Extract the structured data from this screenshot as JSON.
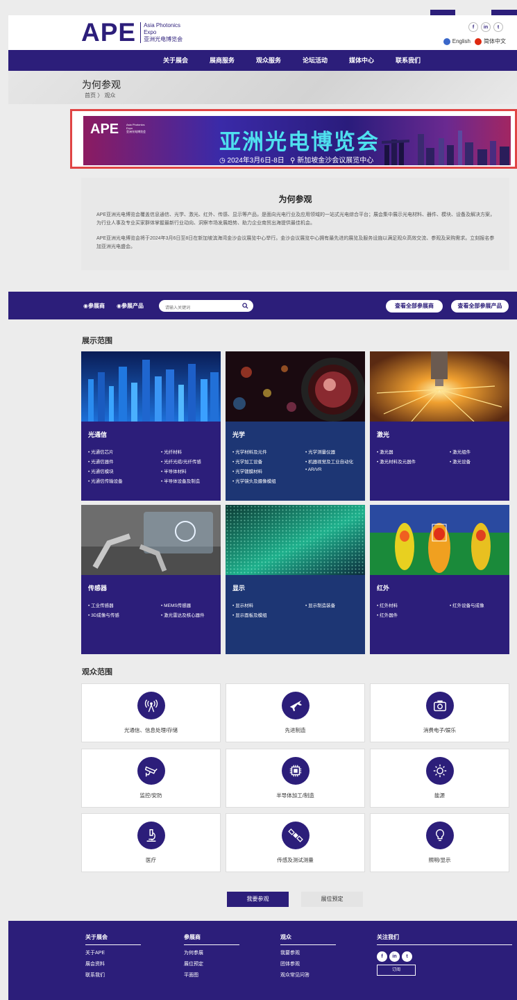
{
  "header": {
    "logo": "APE",
    "logo_sub1": "Asia Photonics",
    "logo_sub2": "Expo",
    "logo_sub3": "亚洲光电博览会",
    "social": [
      "f",
      "in",
      "t"
    ],
    "lang_en": "English",
    "lang_zh": "简体中文"
  },
  "nav": [
    "关于展会",
    "展商服务",
    "观众服务",
    "论坛活动",
    "媒体中心",
    "联系我们"
  ],
  "page": {
    "title": "为何参观",
    "breadcrumb": "首页 〉 观众"
  },
  "banner": {
    "logo": "APE",
    "logo_sub1": "Asia Photonics",
    "logo_sub2": "Expo",
    "logo_sub3": "亚洲光电博览会",
    "title": "亚洲光电博览会",
    "date": "◷ 2024年3月6日-8日",
    "venue": "⚲ 新加坡金沙会议展览中心"
  },
  "intro": {
    "heading": "为何参观",
    "p1": "APE亚洲光电博览会覆盖信息通信、光学、激光、红外、传感、显示等产品，是面向光电行业及应用领域的一站式光电综合平台；展会集中展示光电材料、器件、模块、设备及解决方案，为行业人事及专业买家群体掌握最新行业动向、洞察市场发展趋势、助力企业南贸出海提供最佳机会。",
    "p2": "APE亚洲光电博览会将于2024年3月6日至8日在新加坡滨海湾金沙会议展览中心举行。金沙会议展览中心拥有最先进的展览及服务设施以满足观众高效交流、参观及采购需求。立刻报名参加亚洲光电盛会。"
  },
  "search": {
    "radio1": "◉参展商",
    "radio2": "◉参展产品",
    "placeholder": "请输入关键词",
    "btn_exhibitors": "查看全部参展商",
    "btn_products": "查看全部参展产品"
  },
  "exhibit": {
    "heading": "展示范围",
    "cards": [
      {
        "title": "光通信",
        "items": [
          "• 光通信芯片",
          "• 光纤材料",
          "• 光通信器件",
          "• 光纤光缆/光纤传感",
          "• 光通信模块",
          "• 半导体材料",
          "• 光通信传输设备",
          "• 半导体设备及制造"
        ]
      },
      {
        "title": "光学",
        "items": [
          "• 光学材料及元件",
          "• 光学测量仪器",
          "• 光学加工设备",
          "• 机器视觉及工业自动化",
          "• 光学镀膜材料",
          "• AR/VR",
          "• 光学镜头及摄像模组"
        ]
      },
      {
        "title": "激光",
        "items": [
          "• 激光器",
          "• 激光组件",
          "• 激光材料及元器件",
          "• 激光设备"
        ]
      },
      {
        "title": "传感器",
        "items": [
          "• 工业传感器",
          "• MEMS传感器",
          "• 3D成像与传感",
          "• 激光雷达及核心器件"
        ]
      },
      {
        "title": "显示",
        "items": [
          "• 显示材料",
          "• 显示制造装备",
          "• 显示面板及模组"
        ]
      },
      {
        "title": "红外",
        "items": [
          "• 红外材料",
          "• 红外设备与成像",
          "• 红外器件"
        ]
      }
    ]
  },
  "audience": {
    "heading": "观众范围",
    "items": [
      {
        "label": "光通信、信息处理/存储",
        "icon": "antenna-icon"
      },
      {
        "label": "先进制造",
        "icon": "airplane-icon"
      },
      {
        "label": "消费电子/娱乐",
        "icon": "camera-icon"
      },
      {
        "label": "监控/安防",
        "icon": "security-camera-icon"
      },
      {
        "label": "半导体加工/制造",
        "icon": "chip-icon"
      },
      {
        "label": "能源",
        "icon": "sun-icon"
      },
      {
        "label": "医疗",
        "icon": "microscope-icon"
      },
      {
        "label": "传感及测试测量",
        "icon": "satellite-icon"
      },
      {
        "label": "照明/显示",
        "icon": "bulb-icon"
      }
    ]
  },
  "cta": {
    "visit": "我要参观",
    "booth": "展位预定"
  },
  "footer": {
    "cols": [
      {
        "heading": "关于展会",
        "links": [
          "关于APE",
          "展会资料",
          "联系我们"
        ]
      },
      {
        "heading": "参展商",
        "links": [
          "为何参展",
          "展位预定",
          "平面图"
        ]
      },
      {
        "heading": "观众",
        "links": [
          "我要参观",
          "团体参观",
          "观众常见问答"
        ]
      }
    ],
    "follow": "关注我们",
    "social": [
      "f",
      "in",
      "t"
    ],
    "subscribe": "订阅"
  },
  "colors": {
    "brand": "#2c1e7a",
    "alt": "#1d3674",
    "banner_title": "#4fe0ef"
  }
}
